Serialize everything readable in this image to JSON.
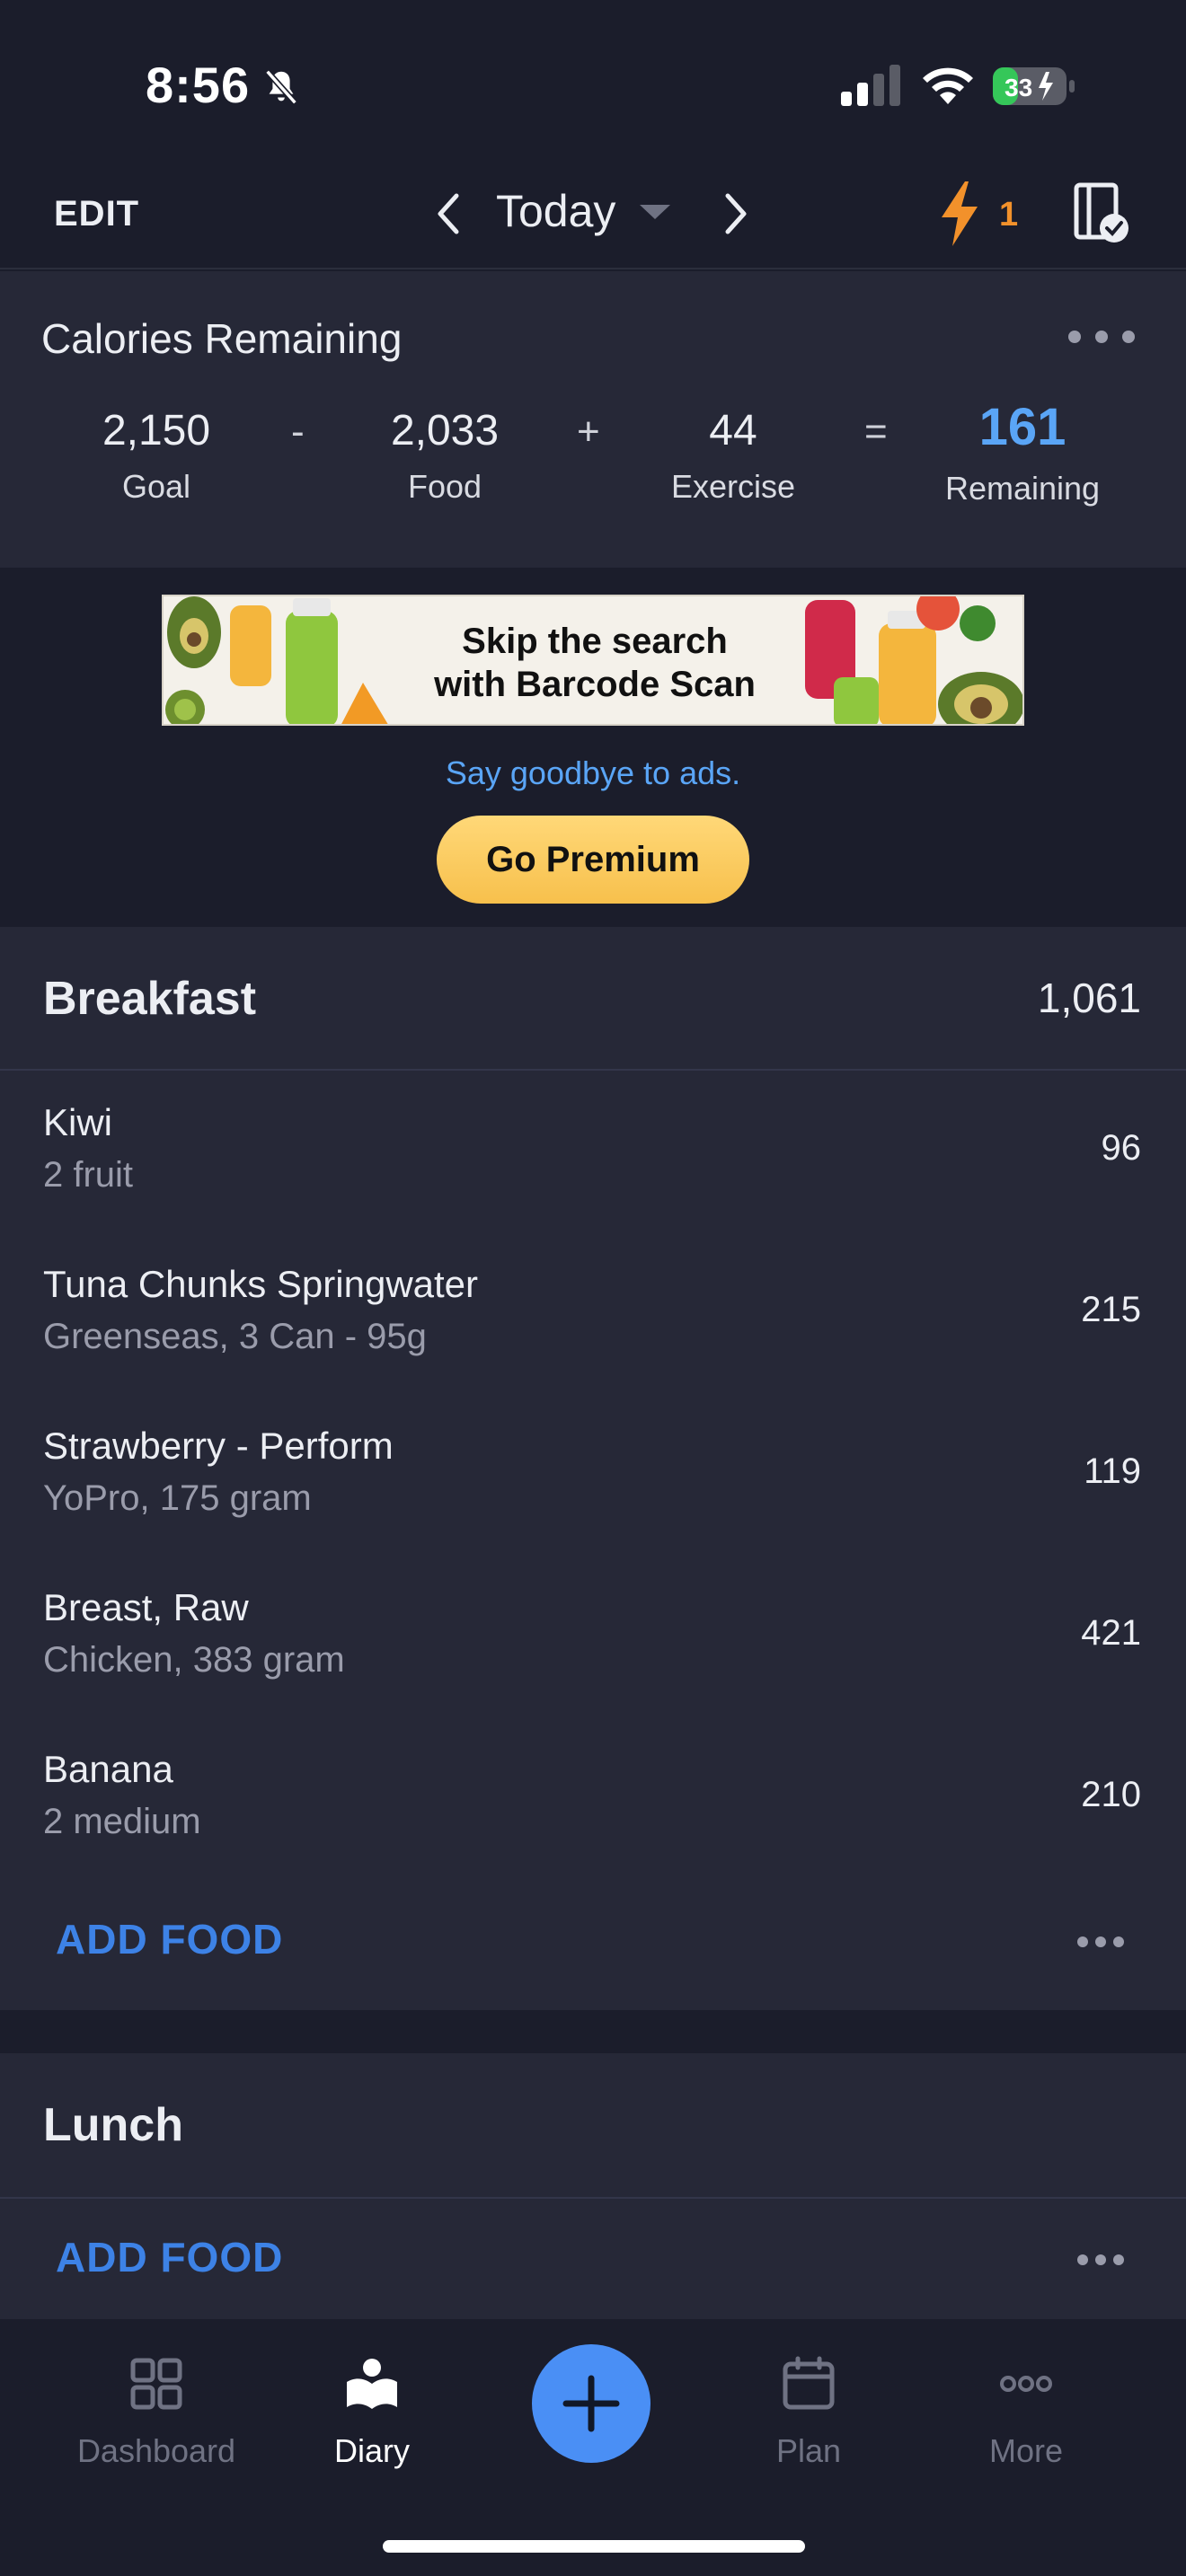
{
  "status_bar": {
    "time": "8:56",
    "battery": "33"
  },
  "top_nav": {
    "edit": "EDIT",
    "date": "Today",
    "streak": "1"
  },
  "calories": {
    "title": "Calories Remaining",
    "goal": {
      "value": "2,150",
      "label": "Goal"
    },
    "food": {
      "value": "2,033",
      "label": "Food"
    },
    "exercise": {
      "value": "44",
      "label": "Exercise"
    },
    "remaining": {
      "value": "161",
      "label": "Remaining"
    },
    "ops": {
      "minus": "-",
      "plus": "+",
      "equals": "="
    }
  },
  "ad": {
    "line1": "Skip the search",
    "line2": "with Barcode Scan",
    "subtext": "Say goodbye to ads.",
    "button": "Go Premium"
  },
  "breakfast": {
    "title": "Breakfast",
    "total": "1,061",
    "items": [
      {
        "name": "Kiwi",
        "detail": "2 fruit",
        "calories": "96"
      },
      {
        "name": "Tuna Chunks Springwater",
        "detail": "Greenseas, 3 Can - 95g",
        "calories": "215"
      },
      {
        "name": "Strawberry - Perform",
        "detail": "YoPro, 175 gram",
        "calories": "119"
      },
      {
        "name": "Breast, Raw",
        "detail": "Chicken, 383 gram",
        "calories": "421"
      },
      {
        "name": "Banana",
        "detail": "2 medium",
        "calories": "210"
      }
    ],
    "add_food": "ADD FOOD"
  },
  "lunch": {
    "title": "Lunch",
    "add_food": "ADD FOOD"
  },
  "tab_bar": {
    "dashboard": "Dashboard",
    "diary": "Diary",
    "plan": "Plan",
    "more": "More"
  },
  "colors": {
    "accent": "#5aa5f6",
    "link": "#3d82e6",
    "streak": "#f2912b",
    "premium": "#f7c04c"
  }
}
